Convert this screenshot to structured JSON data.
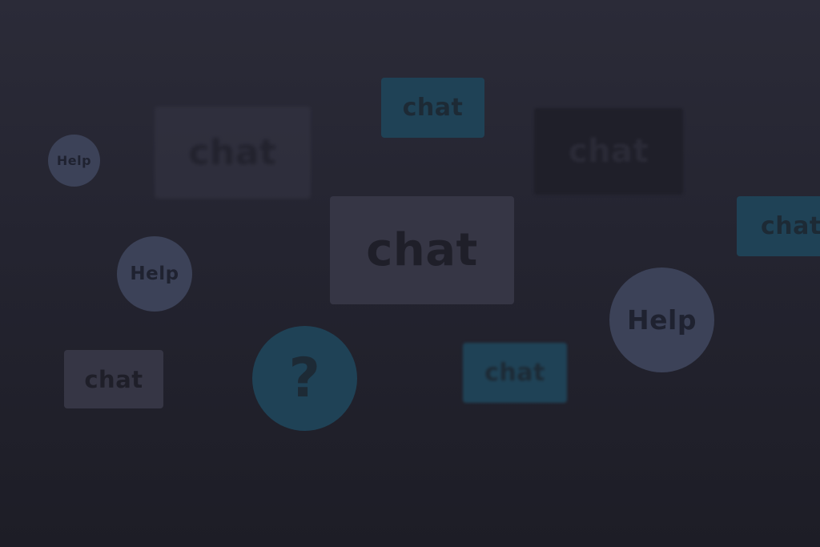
{
  "tiles": {
    "chat_top": "chat",
    "chat_blur_left": "chat",
    "chat_dark": "chat",
    "chat_center": "chat",
    "chat_right": "chat",
    "chat_small": "chat",
    "chat_blur_low": "chat"
  },
  "bubbles": {
    "help_tiny": "Help",
    "help_mid": "Help",
    "help_large": "Help",
    "question": "?"
  },
  "colors": {
    "background_top": "#2b2b38",
    "background_bottom": "#1d1d26",
    "teal": "#1f4256",
    "slate": "#363645",
    "indigo": "#3c4258"
  }
}
